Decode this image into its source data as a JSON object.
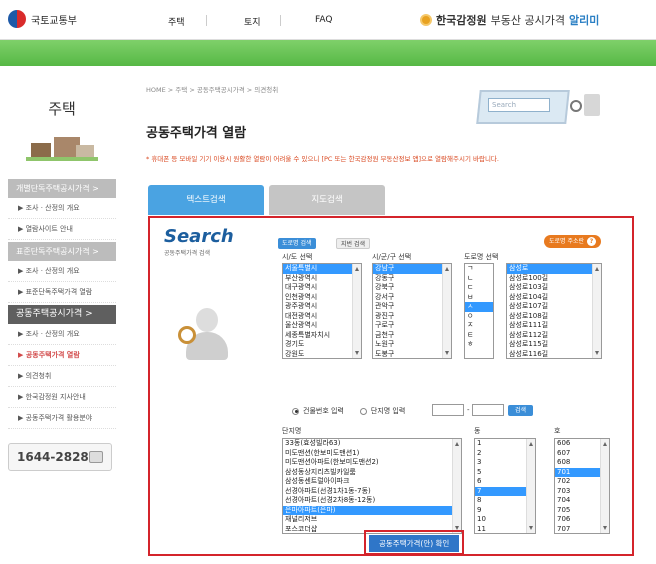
{
  "header": {
    "ministry": "국토교통부",
    "nav": [
      "주택",
      "토지",
      "FAQ"
    ],
    "brand_name": "한국감정원",
    "brand_service": "부동산 공시가격",
    "brand_alimi": "알리미"
  },
  "sidebar": {
    "title": "주택",
    "menu": [
      {
        "label": "개별단독주택공시가격  >",
        "type": "head"
      },
      {
        "label": "▶  조사 · 산정의 개요",
        "type": "sub"
      },
      {
        "label": "▶  열람사이트 안내",
        "type": "sub"
      },
      {
        "label": "표준단독주택공시가격  >",
        "type": "head"
      },
      {
        "label": "▶  조사 · 산정의 개요",
        "type": "sub"
      },
      {
        "label": "▶  표준단독주택가격 열람",
        "type": "sub"
      },
      {
        "label": "공동주택공시가격      >",
        "type": "head-active"
      },
      {
        "label": "▶  조사 · 산정의 개요",
        "type": "sub"
      },
      {
        "label": "▶  공동주택가격 열람",
        "type": "sub-current"
      },
      {
        "label": "▶  의견청취",
        "type": "sub"
      },
      {
        "label": "▶  한국감정원 지사안내",
        "type": "sub"
      },
      {
        "label": "▶  공동주택가격 활용분야",
        "type": "sub"
      }
    ],
    "phone": "1644-2828"
  },
  "breadcrumb": "HOME  >  주택  >  공동주택공시가격  >  의견청취",
  "page_title": "공동주택가격 열람",
  "notice": "* 휴대폰 등 모바일 기기 이용시 원활한 열람이 어려울 수 있으니 [PC 또는 한국감정원 부동산정보 앱]으로 열람해주시기 바랍니다.",
  "hero_search_text": "Search",
  "tabs": [
    "텍스트검색",
    "지도검색"
  ],
  "search": {
    "title": "Search",
    "subtitle": "공동주택가격 검색",
    "btn_road": "도로명 검색",
    "btn_lot": "지번 검색",
    "btn_addr_help": "도로명 주소란",
    "label_sido": "시/도 선택",
    "label_sigungu": "시/군/구 선택",
    "label_road": "도로명 선택",
    "sido": [
      "서울특별시",
      "부산광역시",
      "대구광역시",
      "인천광역시",
      "광주광역시",
      "대전광역시",
      "울산광역시",
      "세종특별자치시",
      "경기도",
      "강원도"
    ],
    "sigungu": [
      "강남구",
      "강동구",
      "강북구",
      "강서구",
      "관악구",
      "광진구",
      "구로구",
      "금천구",
      "노원구",
      "도봉구"
    ],
    "road_initial": [
      "ㄱ",
      "ㄴ",
      "ㄷ",
      "ㅂ",
      "ㅅ",
      "ㅇ",
      "ㅈ",
      "ㅌ",
      "ㅎ"
    ],
    "road": [
      "삼성로",
      "삼성로100길",
      "삼성로103길",
      "삼성로104길",
      "삼성로107길",
      "삼성로108길",
      "삼성로111길",
      "삼성로112길",
      "삼성로115길",
      "삼성로116길"
    ],
    "radio_building": "건물번호 입력",
    "radio_complex": "단지명 입력",
    "btn_search": "검색",
    "label_complex": "단지명",
    "label_dong": "동",
    "label_ho": "호",
    "complex": [
      "33동(효성빌라63)",
      "미도맨션(한보미도맨션1)",
      "미도맨션아파트(한보미도맨션2)",
      "삼성동상지리츠빌카일룸",
      "삼성동센트럴아이파크",
      "선경아파트(선경1차1동-7동)",
      "선경아파트(선경2차8동-12동)",
      "은마아파트(은마)",
      "재널리저브",
      "포스코더샵"
    ],
    "dong": [
      "1",
      "2",
      "3",
      "5",
      "6",
      "7",
      "8",
      "9",
      "10",
      "11"
    ],
    "ho": [
      "606",
      "607",
      "608",
      "701",
      "702",
      "703",
      "704",
      "705",
      "706",
      "707"
    ],
    "confirm": "공동주택가격(안) 확인"
  }
}
